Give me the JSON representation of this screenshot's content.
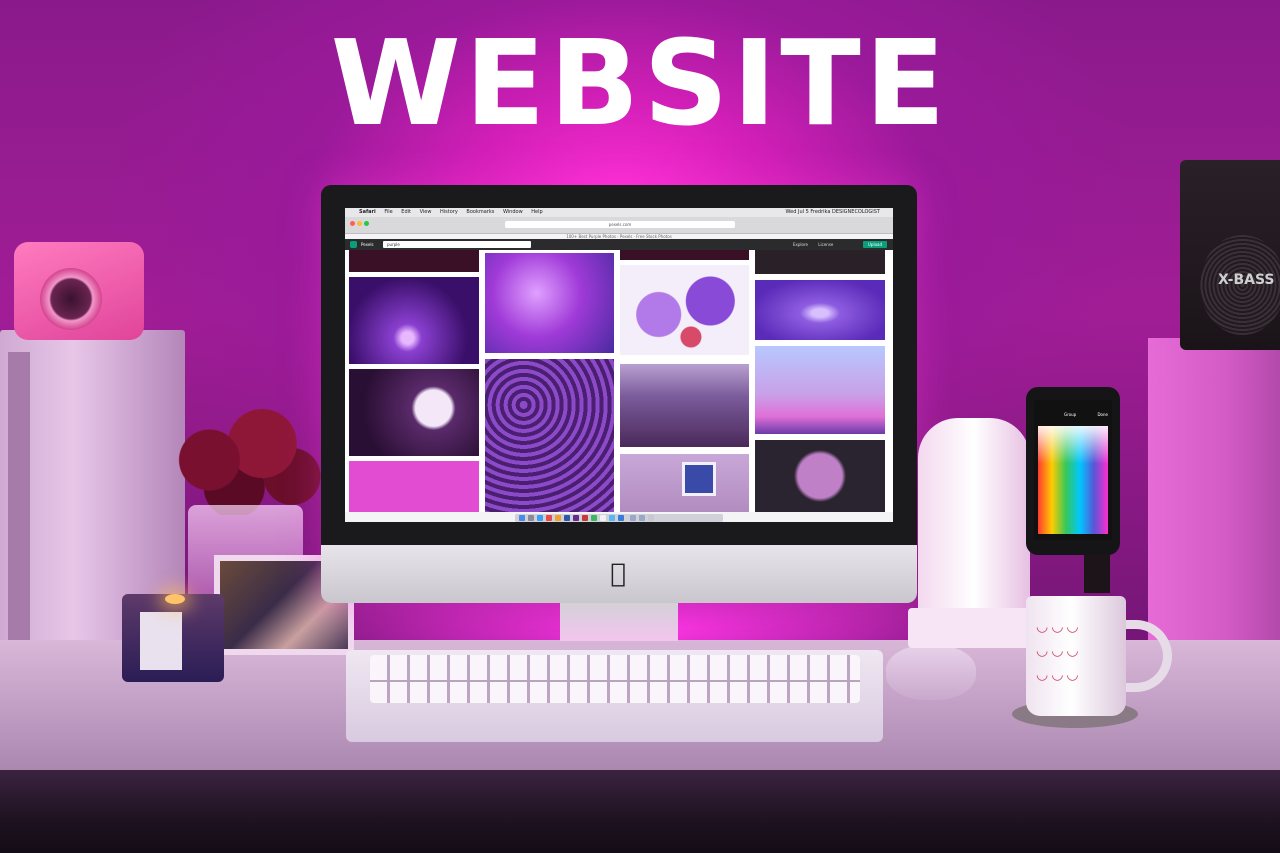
{
  "headline": "WEBSITE",
  "colors": {
    "wall_glow": "#ff2fd6",
    "wall": "#a11d96",
    "accent_green": "#08a07b",
    "desk": "#d8b7d8"
  },
  "screen": {
    "menubar": {
      "apple": "",
      "app": "Safari",
      "items": [
        "File",
        "Edit",
        "View",
        "History",
        "Bookmarks",
        "Window",
        "Help"
      ],
      "right": "Wed Jul 5  Fredrika  DESIGNECOLOGIST"
    },
    "browser": {
      "url": "pexels.com",
      "tab_title": "100+ Best Purple Photos · Pexels · Free Stock Photos"
    },
    "site": {
      "name": "Pexels",
      "search_value": "purple",
      "nav": [
        "Explore",
        "License"
      ],
      "upload_label": "Upload"
    },
    "gallery_tiles": [
      {
        "name": "fiber-optic-lamp",
        "color": "#6a1fb0"
      },
      {
        "name": "purple-ink-cloud",
        "color": "#a03ad8"
      },
      {
        "name": "purple-balloons",
        "color": "#7a3fc6"
      },
      {
        "name": "purple-water-drop",
        "color": "#8d5ce0"
      },
      {
        "name": "white-daisy-dark",
        "color": "#4a1e5a"
      },
      {
        "name": "purple-flower-field",
        "color": "#6b2f9a"
      },
      {
        "name": "lavender-field",
        "color": "#7a5a9a"
      },
      {
        "name": "birds-sunset-sky",
        "color": "#b07ad8"
      },
      {
        "name": "pink-backdrop",
        "color": "#e24cd3"
      },
      {
        "name": "purple-window-wall",
        "color": "#b28cc0"
      },
      {
        "name": "purple-dahlia-dark",
        "color": "#2a2430"
      }
    ]
  },
  "phone": {
    "header_left": "Group",
    "header_right": "Done"
  },
  "speaker": {
    "label": "X-BASS"
  }
}
